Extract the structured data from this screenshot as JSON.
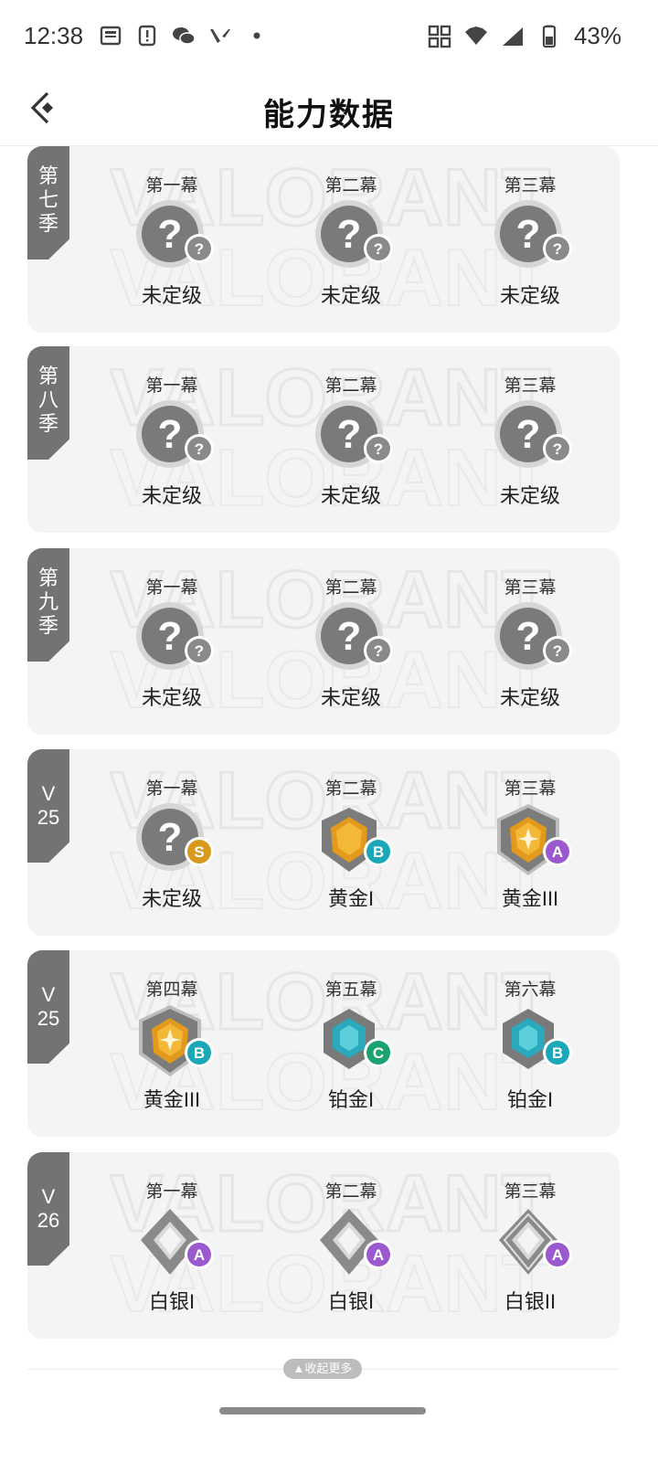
{
  "status_bar": {
    "time": "12:38",
    "battery": "43%"
  },
  "header": {
    "title": "能力数据"
  },
  "watermark_text": "VALORANT",
  "seasons": [
    {
      "tag": [
        "第",
        "七",
        "季"
      ],
      "acts": [
        {
          "name": "第一幕",
          "rank": "未定级",
          "emblem": "unranked",
          "grade": "?"
        },
        {
          "name": "第二幕",
          "rank": "未定级",
          "emblem": "unranked",
          "grade": "?"
        },
        {
          "name": "第三幕",
          "rank": "未定级",
          "emblem": "unranked",
          "grade": "?"
        }
      ]
    },
    {
      "tag": [
        "第",
        "八",
        "季"
      ],
      "acts": [
        {
          "name": "第一幕",
          "rank": "未定级",
          "emblem": "unranked",
          "grade": "?"
        },
        {
          "name": "第二幕",
          "rank": "未定级",
          "emblem": "unranked",
          "grade": "?"
        },
        {
          "name": "第三幕",
          "rank": "未定级",
          "emblem": "unranked",
          "grade": "?"
        }
      ]
    },
    {
      "tag": [
        "第",
        "九",
        "季"
      ],
      "acts": [
        {
          "name": "第一幕",
          "rank": "未定级",
          "emblem": "unranked",
          "grade": "?"
        },
        {
          "name": "第二幕",
          "rank": "未定级",
          "emblem": "unranked",
          "grade": "?"
        },
        {
          "name": "第三幕",
          "rank": "未定级",
          "emblem": "unranked",
          "grade": "?"
        }
      ]
    },
    {
      "tag": [
        "V",
        "25"
      ],
      "acts": [
        {
          "name": "第一幕",
          "rank": "未定级",
          "emblem": "unranked",
          "grade": "S"
        },
        {
          "name": "第二幕",
          "rank": "黄金I",
          "emblem": "gold1",
          "grade": "B"
        },
        {
          "name": "第三幕",
          "rank": "黄金III",
          "emblem": "gold3",
          "grade": "A"
        }
      ]
    },
    {
      "tag": [
        "V",
        "25"
      ],
      "acts": [
        {
          "name": "第四幕",
          "rank": "黄金III",
          "emblem": "gold3",
          "grade": "B"
        },
        {
          "name": "第五幕",
          "rank": "铂金I",
          "emblem": "plat",
          "grade": "C"
        },
        {
          "name": "第六幕",
          "rank": "铂金I",
          "emblem": "plat",
          "grade": "B"
        }
      ]
    },
    {
      "tag": [
        "V",
        "26"
      ],
      "acts": [
        {
          "name": "第一幕",
          "rank": "白银I",
          "emblem": "silver1",
          "grade": "A"
        },
        {
          "name": "第二幕",
          "rank": "白银I",
          "emblem": "silver1",
          "grade": "A"
        },
        {
          "name": "第三幕",
          "rank": "白银II",
          "emblem": "silver2",
          "grade": "A"
        }
      ]
    }
  ],
  "collapse_label": "收起更多",
  "grade_colors": {
    "?": "#8a8a8a",
    "S": "#d99a1c",
    "A": "#9b59d0",
    "B": "#1aa7b8",
    "C": "#1aa36e"
  },
  "icons": [
    "status-app-icons",
    "back-arrow-icon",
    "wifi-icon",
    "signal-icon",
    "battery-icon",
    "chevron-up-icon"
  ]
}
